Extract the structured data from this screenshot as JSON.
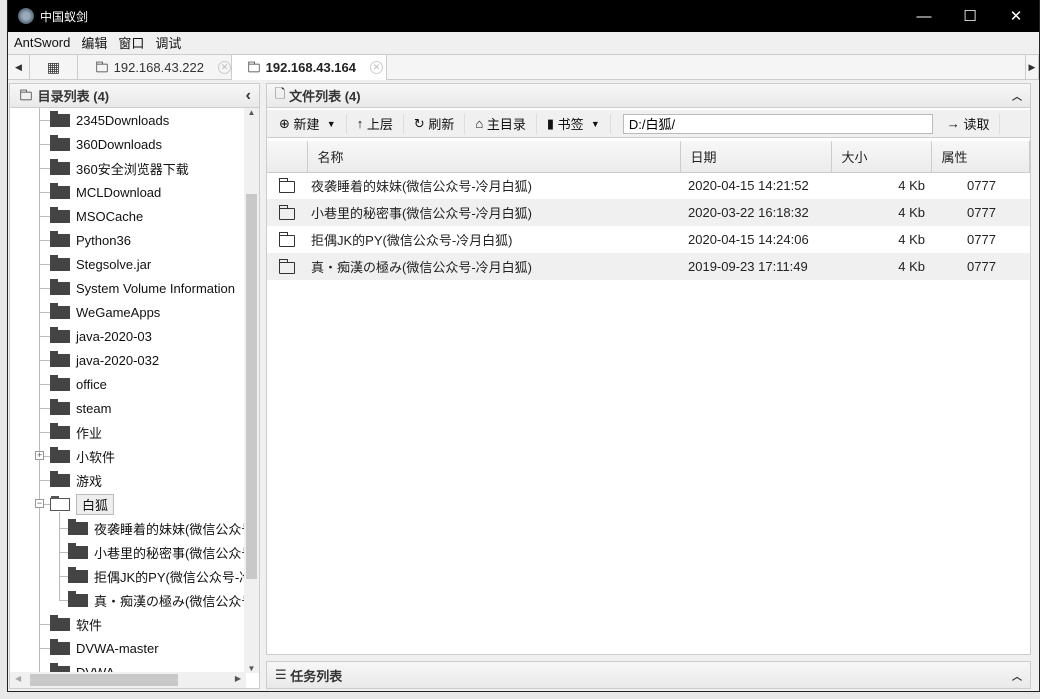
{
  "window": {
    "title": "中国蚁剑",
    "minimize": "—",
    "maximize": "☐",
    "close": "✕"
  },
  "menu": [
    "AntSword",
    "编辑",
    "窗口",
    "调试"
  ],
  "tabs": [
    {
      "label": "192.168.43.222",
      "active": false
    },
    {
      "label": "192.168.43.164",
      "active": true
    }
  ],
  "left_panel": {
    "title": "目录列表 (4)",
    "collapse": "‹",
    "items": [
      {
        "label": "2345Downloads",
        "level": 0
      },
      {
        "label": "360Downloads",
        "level": 0
      },
      {
        "label": "360安全浏览器下载",
        "level": 0
      },
      {
        "label": "MCLDownload",
        "level": 0
      },
      {
        "label": "MSOCache",
        "level": 0
      },
      {
        "label": "Python36",
        "level": 0
      },
      {
        "label": "Stegsolve.jar",
        "level": 0
      },
      {
        "label": "System Volume Information",
        "level": 0
      },
      {
        "label": "WeGameApps",
        "level": 0
      },
      {
        "label": "java-2020-03",
        "level": 0
      },
      {
        "label": "java-2020-032",
        "level": 0
      },
      {
        "label": "office",
        "level": 0
      },
      {
        "label": "steam",
        "level": 0
      },
      {
        "label": "作业",
        "level": 0
      },
      {
        "label": "小软件",
        "level": 0,
        "expander": "+"
      },
      {
        "label": "游戏",
        "level": 0
      },
      {
        "label": "白狐",
        "level": 0,
        "expander": "−",
        "open": true
      },
      {
        "label": "夜袭睡着的妹妹(微信公众号-冷月白狐)",
        "level": 1
      },
      {
        "label": "小巷里的秘密事(微信公众号-冷月白狐)",
        "level": 1
      },
      {
        "label": "拒偶JK的PY(微信公众号-冷月白狐)",
        "level": 1
      },
      {
        "label": "真・痴漢の極み(微信公众号-冷月白狐)",
        "level": 1
      },
      {
        "label": "软件",
        "level": 0
      },
      {
        "label": "DVWA-master",
        "level": 0
      },
      {
        "label": "DVWA",
        "level": 0
      }
    ]
  },
  "right_panel": {
    "title": "文件列表 (4)",
    "toolbar": {
      "new": "新建",
      "up": "上层",
      "refresh": "刷新",
      "home": "主目录",
      "bookmark": "书签",
      "path": "D:/白狐/",
      "read": "读取"
    },
    "columns": [
      "名称",
      "日期",
      "大小",
      "属性"
    ],
    "rows": [
      {
        "name": "夜袭睡着的妹妹(微信公众号-冷月白狐)",
        "date": "2020-04-15 14:21:52",
        "size": "4 Kb",
        "attr": "0777"
      },
      {
        "name": "小巷里的秘密事(微信公众号-冷月白狐)",
        "date": "2020-03-22 16:18:32",
        "size": "4 Kb",
        "attr": "0777"
      },
      {
        "name": "拒偶JK的PY(微信公众号-冷月白狐)",
        "date": "2020-04-15 14:24:06",
        "size": "4 Kb",
        "attr": "0777"
      },
      {
        "name": "真・痴漢の極み(微信公众号-冷月白狐)",
        "date": "2019-09-23 17:11:49",
        "size": "4 Kb",
        "attr": "0777"
      }
    ]
  },
  "task_panel": {
    "title": "任务列表"
  }
}
